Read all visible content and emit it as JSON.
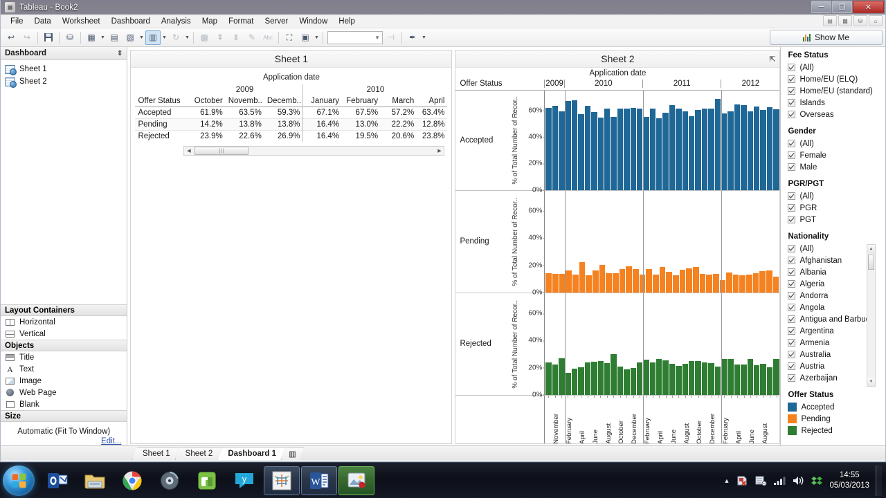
{
  "window": {
    "title": "Tableau - Book2",
    "app_icon": "tableau-icon",
    "buttons": {
      "minimize": "─",
      "maximize": "❐",
      "close": "✕"
    }
  },
  "menubar": {
    "items": [
      "File",
      "Data",
      "Worksheet",
      "Dashboard",
      "Analysis",
      "Map",
      "Format",
      "Server",
      "Window",
      "Help"
    ],
    "right_icons": [
      "data-source-icon",
      "grid-icon",
      "cylinder-icon",
      "home-icon"
    ]
  },
  "toolbar": {
    "show_me_label": "Show Me",
    "show_me_icon": "bar-chart-icon",
    "buttons": [
      {
        "name": "back-button",
        "glyph": "↩"
      },
      {
        "name": "forward-button",
        "glyph": "↪"
      },
      {
        "name": "save-button",
        "glyph": "💾"
      },
      {
        "name": "connect-to-data-button",
        "glyph": "⛁"
      },
      {
        "name": "new-worksheet-button",
        "glyph": "▦"
      },
      {
        "name": "duplicate-sheet-button",
        "glyph": "▤"
      },
      {
        "name": "clear-sheet-button",
        "glyph": "▧"
      },
      {
        "name": "new-dashboard-button",
        "glyph": "▥"
      },
      {
        "name": "refresh-button",
        "glyph": "↻"
      },
      {
        "name": "swap-rows-cols-button",
        "glyph": "▩"
      },
      {
        "name": "sort-ascending-button",
        "glyph": "↑"
      },
      {
        "name": "sort-descending-button",
        "glyph": "↓"
      },
      {
        "name": "highlight-button",
        "glyph": "✎"
      },
      {
        "name": "show-labels-button",
        "glyph": "Abc"
      },
      {
        "name": "presentation-mode-button",
        "glyph": "⬚"
      },
      {
        "name": "fit-dropdown-button",
        "glyph": "▣"
      },
      {
        "name": "fix-axes-button",
        "glyph": "⊣"
      },
      {
        "name": "format-button",
        "glyph": "✒"
      }
    ],
    "combo_value": ""
  },
  "sidebar": {
    "header": "Dashboard",
    "sheets": [
      {
        "label": "Sheet 1",
        "icon": "worksheet-icon"
      },
      {
        "label": "Sheet 2",
        "icon": "worksheet-icon"
      }
    ],
    "layout_containers": {
      "title": "Layout Containers",
      "items": [
        {
          "label": "Horizontal",
          "icon": "horizontal-container-icon"
        },
        {
          "label": "Vertical",
          "icon": "vertical-container-icon"
        }
      ]
    },
    "objects": {
      "title": "Objects",
      "items": [
        {
          "label": "Title",
          "icon": "title-object-icon"
        },
        {
          "label": "Text",
          "icon": "text-object-icon"
        },
        {
          "label": "Image",
          "icon": "image-object-icon"
        },
        {
          "label": "Web Page",
          "icon": "web-page-object-icon"
        },
        {
          "label": "Blank",
          "icon": "blank-object-icon"
        }
      ]
    },
    "size": {
      "title": "Size",
      "value": "Automatic (Fit To Window)",
      "edit_label": "Edit..."
    }
  },
  "sheet1": {
    "title": "Sheet 1",
    "column_field": "Application date",
    "row_header": "Offer Status",
    "years": [
      {
        "label": "2009",
        "span": 3
      },
      {
        "label": "2010",
        "span": 4
      }
    ],
    "months": [
      "October",
      "Novemb..",
      "Decemb..",
      "January",
      "February",
      "March",
      "April"
    ],
    "group_start_index": 3,
    "rows": [
      {
        "label": "Accepted",
        "values": [
          "61.9%",
          "63.5%",
          "59.3%",
          "67.1%",
          "67.5%",
          "57.2%",
          "63.4%"
        ]
      },
      {
        "label": "Pending",
        "values": [
          "14.2%",
          "13.8%",
          "13.8%",
          "16.4%",
          "13.0%",
          "22.2%",
          "12.8%"
        ]
      },
      {
        "label": "Rejected",
        "values": [
          "23.9%",
          "22.6%",
          "26.9%",
          "16.4%",
          "19.5%",
          "20.6%",
          "23.8%"
        ]
      }
    ],
    "scrollbar": {
      "name": "horizontal-scrollbar",
      "thumb_glyph": "|||"
    }
  },
  "sheet2": {
    "title": "Sheet 2",
    "expand_icon": "expand-icon",
    "column_field": "Application date",
    "row_header": "Offer Status"
  },
  "chart_data": {
    "type": "bar",
    "title": "Sheet 2",
    "xlabel": "Application date",
    "ylabel": "% of Total Number of Recor..",
    "ylim": [
      0,
      75
    ],
    "yticks": [
      0,
      20,
      40,
      60
    ],
    "ytick_labels": [
      "0%",
      "20%",
      "40%",
      "60%"
    ],
    "grid": false,
    "legend_position": "right",
    "row_field": "Offer Status",
    "year_groups": [
      {
        "label": "2009",
        "count": 3
      },
      {
        "label": "2010",
        "count": 12
      },
      {
        "label": "2011",
        "count": 12
      },
      {
        "label": "2012",
        "count": 9
      }
    ],
    "x": [
      "2009-Oct",
      "2009-Nov",
      "2009-Dec",
      "2010-Jan",
      "2010-Feb",
      "2010-Mar",
      "2010-Apr",
      "2010-May",
      "2010-Jun",
      "2010-Jul",
      "2010-Aug",
      "2010-Sep",
      "2010-Oct",
      "2010-Nov",
      "2010-Dec",
      "2011-Jan",
      "2011-Feb",
      "2011-Mar",
      "2011-Apr",
      "2011-May",
      "2011-Jun",
      "2011-Jul",
      "2011-Aug",
      "2011-Sep",
      "2011-Oct",
      "2011-Nov",
      "2011-Dec",
      "2012-Jan",
      "2012-Feb",
      "2012-Mar",
      "2012-Apr",
      "2012-May",
      "2012-Jun",
      "2012-Jul",
      "2012-Aug"
    ],
    "xtick_labels": [
      "November",
      "February",
      "April",
      "June",
      "August",
      "October",
      "December",
      "February",
      "April",
      "June",
      "August",
      "October",
      "December",
      "February",
      "April",
      "June",
      "August"
    ],
    "series": [
      {
        "name": "Accepted",
        "color": "#1f6796",
        "values": [
          61.9,
          63.5,
          59.3,
          67.1,
          67.5,
          57.2,
          63.4,
          58.6,
          54.7,
          61.4,
          55.1,
          61.2,
          61.4,
          62.1,
          61.4,
          55.4,
          61.3,
          54.1,
          58.3,
          63.9,
          61.5,
          59.4,
          55.8,
          60.2,
          61.6,
          61.6,
          68.9,
          57.8,
          59.2,
          64.6,
          64.1,
          59.3,
          62.9,
          60.5,
          62.5,
          61.1
        ]
      },
      {
        "name": "Pending",
        "color": "#f58220",
        "values": [
          14.2,
          13.8,
          13.8,
          16.4,
          13.0,
          22.2,
          12.8,
          16.3,
          20.1,
          14.2,
          14.0,
          17.4,
          19.5,
          17.4,
          13.4,
          17.2,
          13.3,
          18.8,
          15.5,
          12.7,
          16.8,
          17.9,
          19.0,
          13.7,
          13.2,
          13.7,
          9.2,
          14.7,
          13.1,
          12.5,
          13.2,
          14.3,
          15.8,
          16.1,
          11.5
        ]
      },
      {
        "name": "Rejected",
        "color": "#2f7d32",
        "values": [
          23.9,
          22.6,
          26.9,
          16.4,
          19.5,
          20.6,
          23.8,
          24.4,
          25.1,
          23.5,
          29.8,
          21.1,
          18.9,
          19.8,
          24.1,
          26.2,
          23.9,
          26.6,
          25.4,
          23.1,
          21.2,
          23.0,
          24.9,
          25.0,
          23.8,
          23.4,
          21.0,
          26.5,
          26.6,
          22.5,
          22.2,
          26.6,
          22.1,
          22.8,
          20.3,
          26.5
        ]
      }
    ]
  },
  "filters": {
    "fee_status": {
      "title": "Fee Status",
      "items": [
        {
          "label": "(All)",
          "checked": true
        },
        {
          "label": "Home/EU (ELQ)",
          "checked": true
        },
        {
          "label": "Home/EU (standard)",
          "checked": true
        },
        {
          "label": "Islands",
          "checked": true
        },
        {
          "label": "Overseas",
          "checked": true
        }
      ]
    },
    "gender": {
      "title": "Gender",
      "items": [
        {
          "label": "(All)",
          "checked": true
        },
        {
          "label": "Female",
          "checked": true
        },
        {
          "label": "Male",
          "checked": true
        }
      ]
    },
    "pgr_pgt": {
      "title": "PGR/PGT",
      "items": [
        {
          "label": "(All)",
          "checked": true
        },
        {
          "label": "PGR",
          "checked": true
        },
        {
          "label": "PGT",
          "checked": true
        }
      ]
    },
    "nationality": {
      "title": "Nationality",
      "items": [
        {
          "label": "(All)",
          "checked": true
        },
        {
          "label": "Afghanistan",
          "checked": true
        },
        {
          "label": "Albania",
          "checked": true
        },
        {
          "label": "Algeria",
          "checked": true
        },
        {
          "label": "Andorra",
          "checked": true
        },
        {
          "label": "Angola",
          "checked": true
        },
        {
          "label": "Antigua and Barbuda",
          "checked": true
        },
        {
          "label": "Argentina",
          "checked": true
        },
        {
          "label": "Armenia",
          "checked": true
        },
        {
          "label": "Australia",
          "checked": true
        },
        {
          "label": "Austria",
          "checked": true
        },
        {
          "label": "Azerbaijan",
          "checked": true
        }
      ]
    },
    "legend": {
      "title": "Offer Status",
      "items": [
        {
          "label": "Accepted",
          "color": "#1f6796"
        },
        {
          "label": "Pending",
          "color": "#f58220"
        },
        {
          "label": "Rejected",
          "color": "#2f7d32"
        }
      ]
    }
  },
  "worksheet_tabs": {
    "items": [
      {
        "label": "Sheet 1",
        "active": false
      },
      {
        "label": "Sheet 2",
        "active": false
      },
      {
        "label": "Dashboard 1",
        "active": true
      }
    ],
    "new_tab_icon": "new-dashboard-tab-icon"
  },
  "taskbar": {
    "start_label": "start-orb",
    "items": [
      {
        "name": "outlook-taskbar-icon",
        "glyph": "O",
        "open": false
      },
      {
        "name": "file-explorer-taskbar-icon",
        "glyph": "🗁",
        "open": false
      },
      {
        "name": "chrome-taskbar-icon",
        "glyph": "◉",
        "open": false
      },
      {
        "name": "media-taskbar-icon",
        "glyph": "◐",
        "open": false
      },
      {
        "name": "evernote-taskbar-icon",
        "glyph": "Е",
        "open": false
      },
      {
        "name": "yammer-taskbar-icon",
        "glyph": "y",
        "open": false
      },
      {
        "name": "tableau-taskbar-icon",
        "glyph": "✦",
        "open": true
      },
      {
        "name": "word-taskbar-icon",
        "glyph": "W",
        "open": true
      },
      {
        "name": "snagit-taskbar-icon",
        "glyph": "▰",
        "open": true
      }
    ],
    "tray": {
      "icons": [
        "tray-expand-icon",
        "security-icon",
        "network-share-icon",
        "signal-icon",
        "volume-icon",
        "dropbox-icon"
      ],
      "time": "14:55",
      "date": "05/03/2013"
    }
  }
}
